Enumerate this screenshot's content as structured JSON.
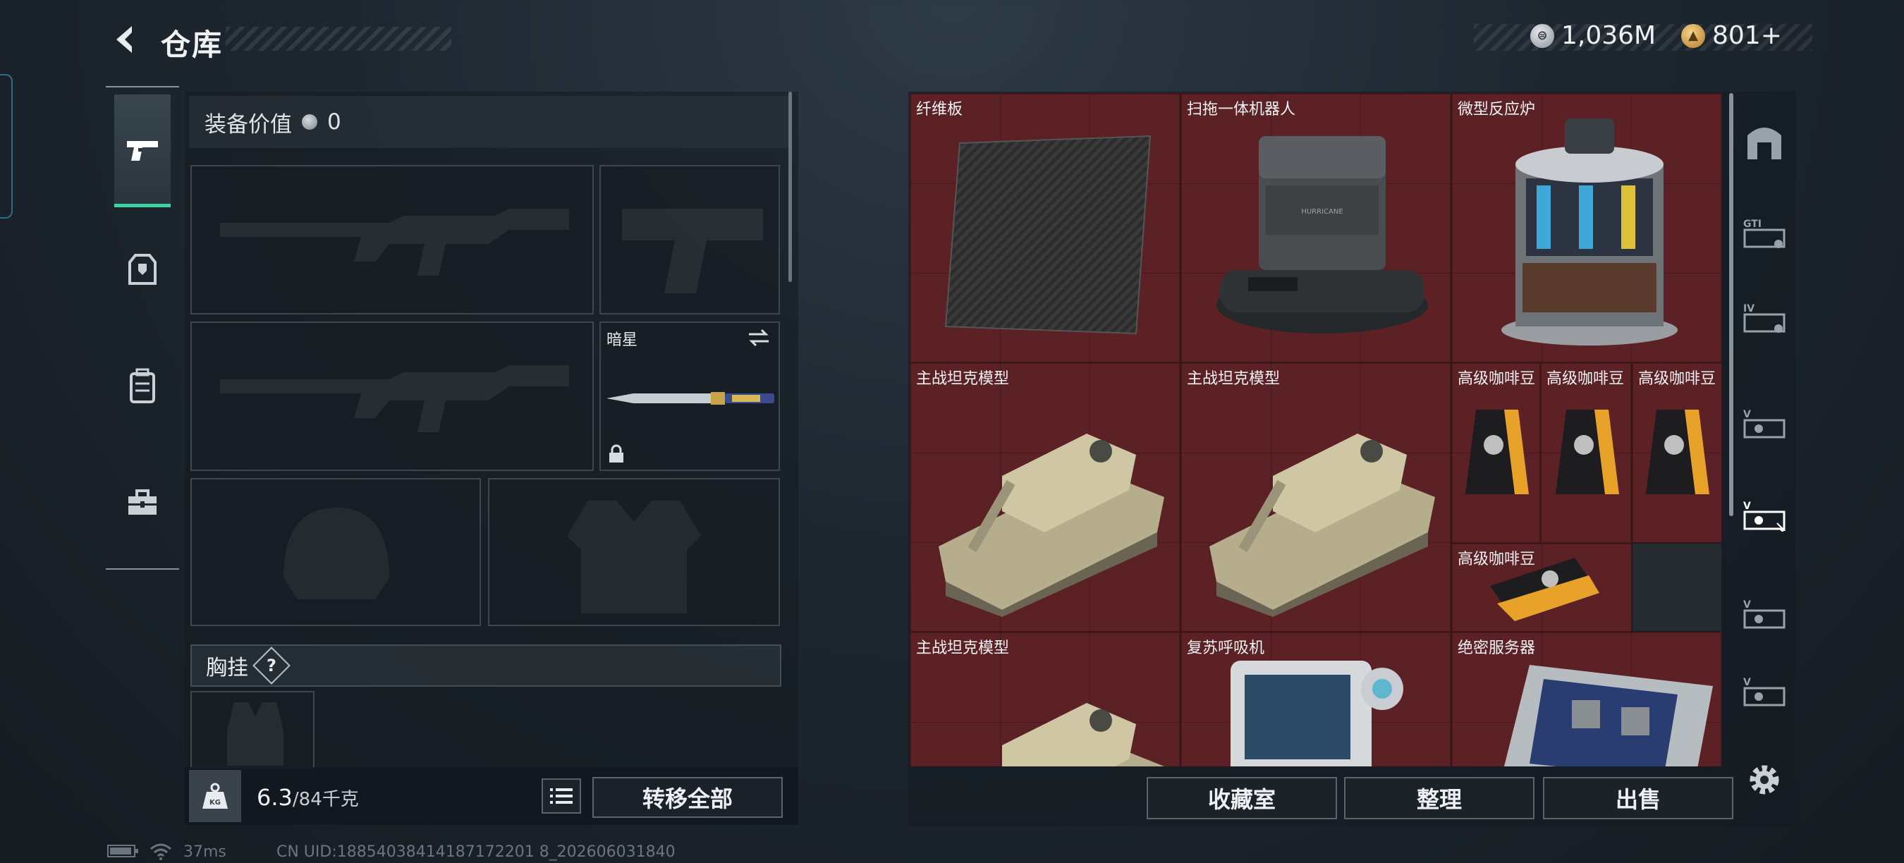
{
  "header": {
    "title": "仓库",
    "currency": [
      {
        "icon": "silver-coin-icon",
        "value": "1,036M"
      },
      {
        "icon": "gold-triangle-icon",
        "value": "801+"
      }
    ]
  },
  "categories": [
    {
      "name": "weapon",
      "icon": "pistol-icon",
      "active": true
    },
    {
      "name": "armor",
      "icon": "armor-icon",
      "active": false
    },
    {
      "name": "backpack",
      "icon": "backpack-icon",
      "active": false
    },
    {
      "name": "toolbox",
      "icon": "toolbox-icon",
      "active": false
    }
  ],
  "equipment": {
    "value_label": "装备价值",
    "value": "0",
    "knife_label": "暗星",
    "chest_rig_label": "胸挂",
    "chest_rig_help": "?"
  },
  "inventory": {
    "weight_current": "6.3",
    "weight_max": "/84千克",
    "transfer_all": "转移全部"
  },
  "storage": {
    "items": [
      {
        "label": "纤维板"
      },
      {
        "label": "扫拖一体机器人"
      },
      {
        "label": "微型反应炉"
      },
      {
        "label": "主战坦克模型"
      },
      {
        "label": "主战坦克模型"
      },
      {
        "label": "高级咖啡豆"
      },
      {
        "label": "高级咖啡豆"
      },
      {
        "label": "高级咖啡豆"
      },
      {
        "label": "高级咖啡豆"
      },
      {
        "label": "主战坦克模型"
      },
      {
        "label": "复苏呼吸机"
      },
      {
        "label": "绝密服务器"
      }
    ],
    "robot_brand": "HURRICANE"
  },
  "actions": {
    "collection": "收藏室",
    "organize": "整理",
    "sell": "出售"
  },
  "filters": [
    "home-icon",
    "GT-tier-icon",
    "IV-tier-icon",
    "V-tier-icon",
    "V-tier-icon",
    "V-tier-icon",
    "V-tier-icon"
  ],
  "status": {
    "ping": "37ms",
    "uid": "CN UID:18854038414187172201 8_202606031840"
  },
  "colors": {
    "accent": "#3ed3a6",
    "grid_bg": "#5c2125"
  }
}
